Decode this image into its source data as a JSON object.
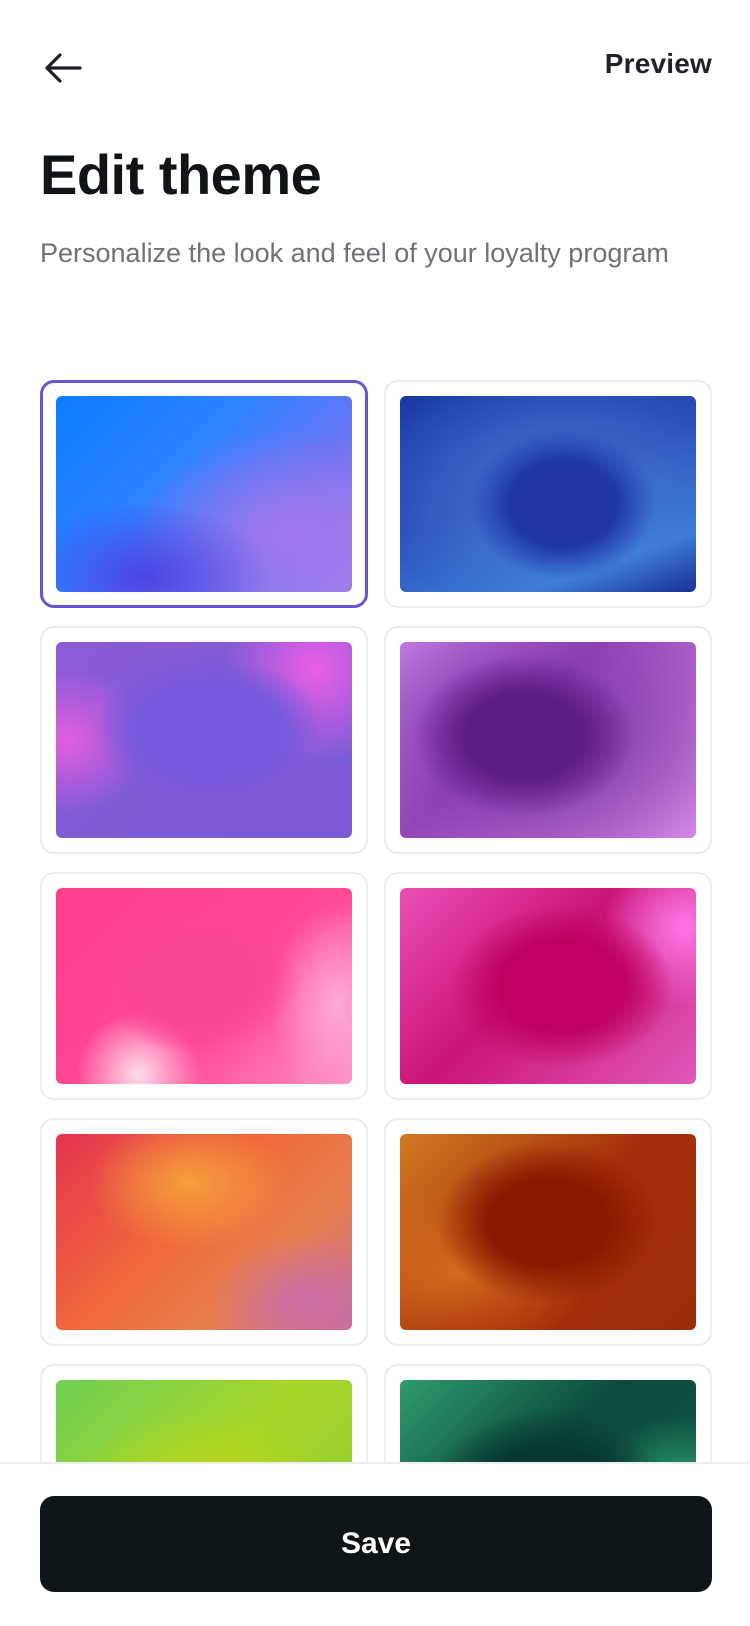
{
  "header": {
    "back_icon": "arrow-left-icon",
    "preview_label": "Preview"
  },
  "page": {
    "title": "Edit theme",
    "subtitle": "Personalize the look and feel of your loyalty program"
  },
  "themes": {
    "selected_index": 0,
    "items": [
      {
        "colors": [
          "#0a7dff",
          "#6e74f2",
          "#9d84ea"
        ]
      },
      {
        "colors": [
          "#1a3aa6",
          "#3b7bd8",
          "#1b2f98"
        ]
      },
      {
        "colors": [
          "#8c5ad8",
          "#7d5bd6",
          "#f05fe6"
        ]
      },
      {
        "colors": [
          "#c27ae0",
          "#5c1e84",
          "#d58ce6"
        ]
      },
      {
        "colors": [
          "#ff3f8c",
          "#ff4a96",
          "#ff8fc4"
        ]
      },
      {
        "colors": [
          "#ea4fb6",
          "#be005f",
          "#e05ab8"
        ]
      },
      {
        "colors": [
          "#e5334f",
          "#f6a03c",
          "#cd6d92"
        ]
      },
      {
        "colors": [
          "#d17a22",
          "#8a1800",
          "#9a2d06"
        ]
      },
      {
        "colors": [
          "#6fcf53",
          "#bed714",
          "#8ccb2f"
        ]
      },
      {
        "colors": [
          "#2f9b6b",
          "#063730",
          "#32b46e"
        ]
      }
    ]
  },
  "footer": {
    "save_label": "Save"
  },
  "colors": {
    "accent_selected_border": "#6b53d6",
    "primary_button": "#0e1518",
    "subtitle_text": "#6f7376"
  }
}
